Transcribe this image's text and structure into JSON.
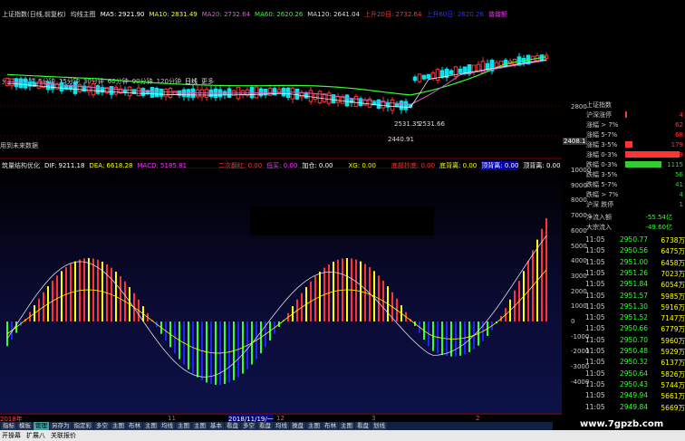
{
  "top": {
    "periods": [
      "分时",
      "1分钟",
      "5分钟",
      "15分钟",
      "30分钟",
      "60分钟",
      "90分钟",
      "120分钟",
      "日线",
      "更多"
    ]
  },
  "ma": {
    "title": "上证指数(日线,前复权)",
    "main": "均线主图",
    "ma5": "MA5: 2921.90",
    "ma10": "MA10: 2831.49",
    "ma20": "MA20: 2732.64",
    "ma60": "MA60: 2620.26",
    "ma120": "MA120: 2641.04",
    "up20": "上升20日: 2732.64",
    "up60": "上升60日: 2620.26",
    "tag": "谐谐额"
  },
  "price": {
    "high_label": "2531.35",
    "mid_label": "2531.66",
    "low_label": "2440.91",
    "right_tick": "2800",
    "cur_tick": "2408.1",
    "note": "用到未来数据"
  },
  "macd": {
    "title": "筑量结构优化",
    "dif": "DIF: 9211.18",
    "dea": "DEA: 6618.28",
    "macd": "MACD: 5185.81",
    "i1": "二次翻红: 0.00",
    "i2": "低买: 0.00",
    "i3": "加仓: 0.00",
    "i4": "XG: 0.00",
    "i5": "底部抄底: 0.00",
    "i6": "底背离: 0.00",
    "i7": "顶背离: 0.00",
    "i8": "顶背离: 0.00"
  },
  "macd_axis": [
    "10000",
    "9000",
    "8000",
    "7000",
    "6000",
    "5000",
    "4000",
    "3000",
    "2000",
    "1000",
    "0",
    "-1000",
    "-2000",
    "-3000",
    "-4000"
  ],
  "right_stats": [
    {
      "label": "上证指数",
      "value": "",
      "color": "#ccc"
    },
    {
      "label": "沪深涨停",
      "value": "4",
      "color": "#f33"
    },
    {
      "label": "涨幅 > 7%",
      "value": "62",
      "color": "#f33"
    },
    {
      "label": "涨幅 5-7%",
      "value": "68",
      "color": "#f33"
    },
    {
      "label": "涨幅 3-5%",
      "value": "179",
      "color": "#f33"
    },
    {
      "label": "涨幅 0-3%",
      "value": "1819",
      "color": "#f33"
    },
    {
      "label": "跌幅 0-3%",
      "value": "1115",
      "color": "#3c3"
    },
    {
      "label": "跌幅 3-5%",
      "value": "56",
      "color": "#3c3"
    },
    {
      "label": "跌幅 5-7%",
      "value": "41",
      "color": "#3c3"
    },
    {
      "label": "跌幅 > 7%",
      "value": "4",
      "color": "#3c3"
    },
    {
      "label": "沪深 跌停",
      "value": "1",
      "color": "#3c3"
    }
  ],
  "flow": [
    {
      "label": "净流入额",
      "value": "-55.54亿"
    },
    {
      "label": "大宗流入",
      "value": "-49.60亿"
    }
  ],
  "ticks": [
    {
      "t": "11:05",
      "p": "2950.77",
      "v": "6738万"
    },
    {
      "t": "11:05",
      "p": "2950.56",
      "v": "6475万"
    },
    {
      "t": "11:05",
      "p": "2951.00",
      "v": "6458万"
    },
    {
      "t": "11:05",
      "p": "2951.26",
      "v": "7023万"
    },
    {
      "t": "11:05",
      "p": "2951.84",
      "v": "6054万"
    },
    {
      "t": "11:05",
      "p": "2951.57",
      "v": "5985万"
    },
    {
      "t": "11:05",
      "p": "2951.30",
      "v": "5916万"
    },
    {
      "t": "11:05",
      "p": "2951.52",
      "v": "7147万"
    },
    {
      "t": "11:05",
      "p": "2950.66",
      "v": "6779万"
    },
    {
      "t": "11:05",
      "p": "2950.70",
      "v": "5960万"
    },
    {
      "t": "11:05",
      "p": "2950.48",
      "v": "5929万"
    },
    {
      "t": "11:05",
      "p": "2950.32",
      "v": "6137万"
    },
    {
      "t": "11:05",
      "p": "2950.64",
      "v": "5826万"
    },
    {
      "t": "11:05",
      "p": "2950.43",
      "v": "5744万"
    },
    {
      "t": "11:05",
      "p": "2949.94",
      "v": "5661万"
    },
    {
      "t": "11:05",
      "p": "2949.84",
      "v": "5669万"
    }
  ],
  "time_axis": [
    "2018年",
    "11",
    "2018/11/19/一",
    "12",
    "3",
    "2"
  ],
  "bottom_tabs": [
    "指标",
    "模板",
    "管理",
    "另存为",
    "指定彩",
    "多空",
    "主图",
    "布林",
    "主图",
    "均线",
    "主图",
    "主图",
    "基本",
    "看盘",
    "多空",
    "看盘",
    "均线",
    "操盘",
    "主图",
    "布林",
    "主图",
    "看盘",
    "划线"
  ],
  "status": [
    "开操幕",
    "扩展八",
    "关联报价"
  ],
  "watermark": "www.7gpzb.com",
  "colors": {
    "up": "#f33",
    "down": "#00e5ee",
    "ma_green": "#3f3",
    "ma_purple": "#c6c",
    "ma_white": "#fff",
    "ma_yellow": "#ff0"
  }
}
